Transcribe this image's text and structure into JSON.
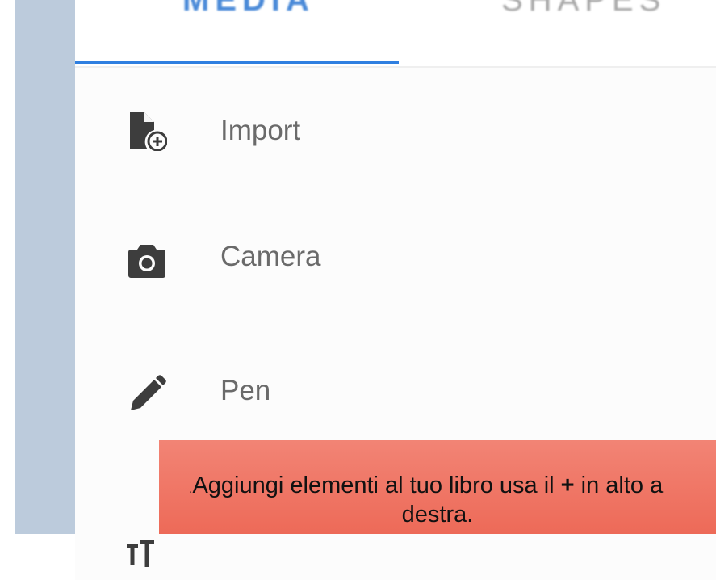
{
  "tabs": {
    "media": "MEDIA",
    "shapes": "SHAPES"
  },
  "menu": {
    "items": [
      {
        "label": "Import",
        "icon": "import-file-icon"
      },
      {
        "label": "Camera",
        "icon": "camera-icon"
      },
      {
        "label": "Pen",
        "icon": "pen-icon"
      },
      {
        "label": "",
        "icon": "text-icon"
      }
    ]
  },
  "banner": {
    "prefix": ".",
    "line1_before": "Aggiungi elementi al tuo libro usa il ",
    "plus": "+",
    "line1_after": " in alto a",
    "line2": "destra."
  },
  "colors": {
    "accent": "#2f7fe0",
    "rail": "#bccbdc",
    "banner": "#ef7462"
  }
}
